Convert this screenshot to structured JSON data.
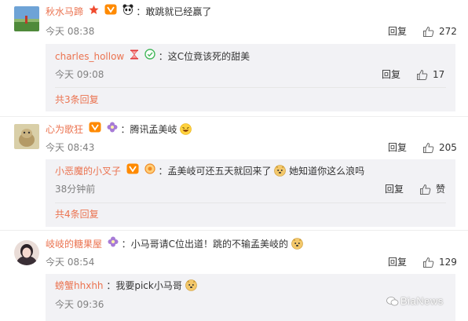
{
  "comments": [
    {
      "username": "秋水马蹄",
      "text": "：敢跳就已经赢了",
      "time": "今天 08:38",
      "reply_label": "回复",
      "likes": "272",
      "sub": {
        "username": "charles_hollow",
        "text": "：这C位竟该死的甜美",
        "time": "今天 09:08",
        "reply_label": "回复",
        "likes": "17",
        "more_label": "共3条回复"
      }
    },
    {
      "username": "心为歌狂",
      "text": "：腾讯孟美岐",
      "time": "今天 08:43",
      "reply_label": "回复",
      "likes": "205",
      "sub": {
        "username": "小恶魔的小叉子",
        "text_before": "：孟美岐可还五天就回来了",
        "text_after": "她知道你这么浪吗",
        "time": "38分钟前",
        "reply_label": "回复",
        "likes": "赞",
        "more_label": "共4条回复"
      }
    },
    {
      "username": "岐岐的糖果屋",
      "text_before": "：小马哥请C位出道！跳的不输孟美岐的",
      "time": "今天 08:54",
      "reply_label": "回复",
      "likes": "129",
      "sub": {
        "username": "螃蟹hhxhh",
        "text": "：我要pick小马哥",
        "time": "今天 09:36"
      }
    }
  ],
  "watermark": "BiaNews",
  "colors": {
    "username": "#eb7350",
    "time": "#808080",
    "sub_bg": "#f2f2f5"
  }
}
